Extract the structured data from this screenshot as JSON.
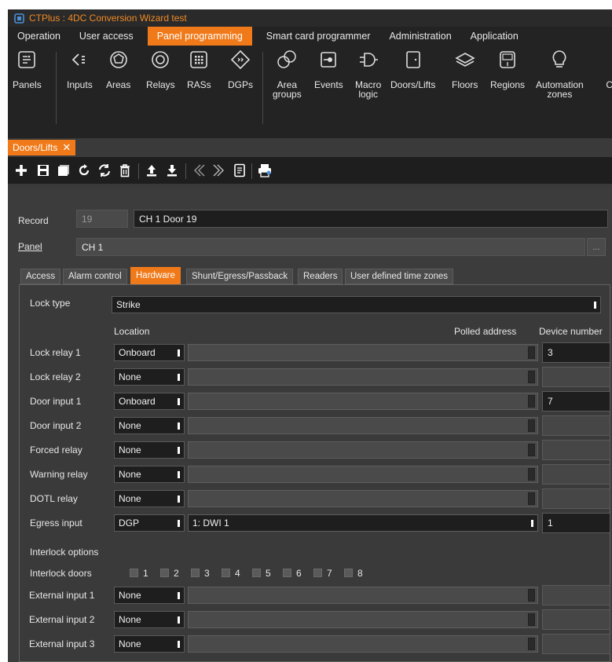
{
  "titlebar": {
    "title": "CTPlus : 4DC Conversion Wizard test",
    "accent": "#f08a24"
  },
  "menu": [
    "Operation",
    "User access",
    "Panel programming",
    "Smart card programmer",
    "Administration",
    "Application"
  ],
  "ribbon": [
    {
      "label": "Panels",
      "icon": "panels-icon"
    },
    {
      "label": "Inputs",
      "icon": "inputs-icon"
    },
    {
      "label": "Areas",
      "icon": "areas-icon"
    },
    {
      "label": "Relays",
      "icon": "relays-icon"
    },
    {
      "label": "RASs",
      "icon": "ras-icon"
    },
    {
      "label": "DGPs",
      "icon": "dgp-icon"
    },
    {
      "label": "Area\ngroups",
      "icon": "area-groups-icon"
    },
    {
      "label": "Events",
      "icon": "events-icon"
    },
    {
      "label": "Macro\nlogic",
      "icon": "macro-logic-icon"
    },
    {
      "label": "Doors/Lifts",
      "icon": "door-icon"
    },
    {
      "label": "Floors",
      "icon": "floors-icon"
    },
    {
      "label": "Regions",
      "icon": "regions-icon"
    },
    {
      "label": "Automation\nzones",
      "icon": "bulb-icon"
    },
    {
      "label": "Co",
      "icon": ""
    }
  ],
  "doc_tab": {
    "label": "Doors/Lifts",
    "close": "✕"
  },
  "record": {
    "label": "Record",
    "id": "19",
    "name": "CH 1 Door 19"
  },
  "panel_field": {
    "label": "Panel",
    "value": "CH 1",
    "button": "..."
  },
  "tabs": [
    "Access",
    "Alarm control",
    "Hardware",
    "Shunt/Egress/Passback",
    "Readers",
    "User defined time zones"
  ],
  "hardware": {
    "lock_type_label": "Lock type",
    "lock_type": "Strike",
    "col_location": "Location",
    "col_polled": "Polled address",
    "col_device": "Device number",
    "rows": [
      {
        "label": "Lock relay 1",
        "location": "Onboard",
        "address": "",
        "device": "3"
      },
      {
        "label": "Lock relay 2",
        "location": "None",
        "address": "",
        "device": ""
      },
      {
        "label": "Door input 1",
        "location": "Onboard",
        "address": "",
        "device": "7"
      },
      {
        "label": "Door input 2",
        "location": "None",
        "address": "",
        "device": ""
      },
      {
        "label": "Forced relay",
        "location": "None",
        "address": "",
        "device": ""
      },
      {
        "label": "Warning relay",
        "location": "None",
        "address": "",
        "device": ""
      },
      {
        "label": "DOTL relay",
        "location": "None",
        "address": "",
        "device": ""
      },
      {
        "label": "Egress input",
        "location": "DGP",
        "address": "1: DWI 1",
        "device": "1"
      }
    ],
    "interlock_options_label": "Interlock options",
    "interlock_doors_label": "Interlock doors",
    "interlock_doors": [
      "1",
      "2",
      "3",
      "4",
      "5",
      "6",
      "7",
      "8"
    ],
    "external_rows": [
      {
        "label": "External input 1",
        "location": "None",
        "address": "",
        "device": ""
      },
      {
        "label": "External input 2",
        "location": "None",
        "address": "",
        "device": ""
      },
      {
        "label": "External input 3",
        "location": "None",
        "address": "",
        "device": ""
      }
    ]
  }
}
